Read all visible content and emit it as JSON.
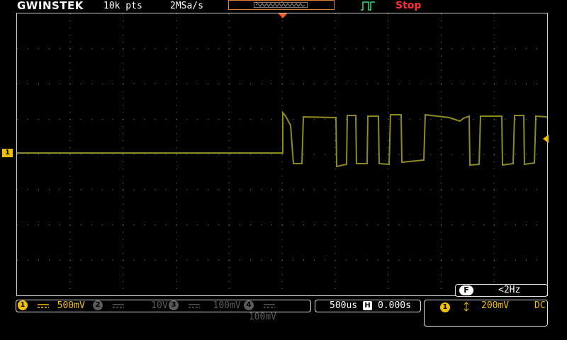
{
  "header": {
    "brand": "GWINSTEK",
    "record_length": "10k pts",
    "sample_rate": "2MSa/s",
    "status": "Stop"
  },
  "channels": [
    {
      "id": "1",
      "scale": "500mV",
      "active": true,
      "color": "#f0c000"
    },
    {
      "id": "2",
      "scale": "10V",
      "active": false,
      "color": "#5a5a5a"
    },
    {
      "id": "3",
      "scale": "100mV",
      "active": false,
      "color": "#5a5a5a"
    },
    {
      "id": "4",
      "scale": "100mV",
      "active": false,
      "color": "#5a5a5a"
    }
  ],
  "timebase": {
    "scale": "500us",
    "position": "0.000s"
  },
  "trigger": {
    "source": "1",
    "level": "200mV",
    "coupling": "DC"
  },
  "frequency": {
    "icon": "F",
    "value": "<2Hz"
  },
  "ch1_marker_label": "1",
  "colors": {
    "trace": "#8f8a1e",
    "grid_dots": "#8a8a8a",
    "status": "#ff2d2d",
    "accent": "#f0c000",
    "trigger_pos": "#ff5a20"
  }
}
